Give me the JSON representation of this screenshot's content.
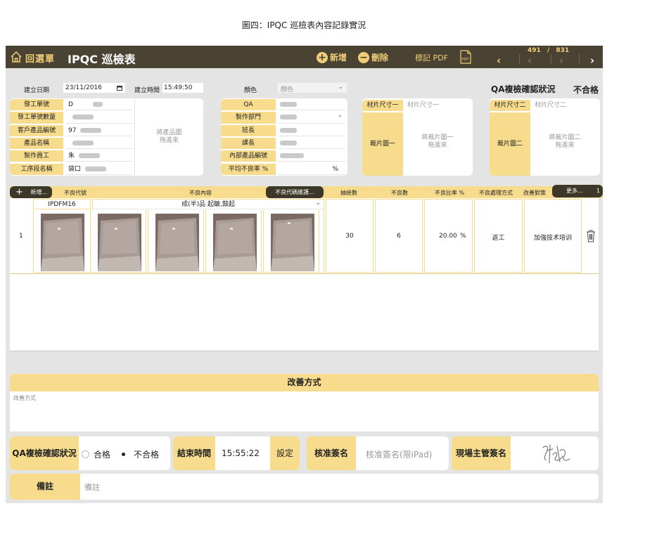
{
  "caption": "圖四：IPQC 巡檢表內容記錄實況",
  "header": {
    "back_label": "回選單",
    "title": "IPQC 巡檢表",
    "add_label": "新增",
    "delete_label": "刪除",
    "pdf_label": "標記 PDF",
    "pager_current": "491",
    "pager_sep": "/",
    "pager_total": "831"
  },
  "form": {
    "date_label": "建立日期",
    "date_value": "23/11/2016",
    "time_label": "建立時間",
    "time_value": "15:49:50",
    "color_label": "顏色",
    "color_placeholder": "顏色",
    "qa_status_title": "QA複檢確認狀況",
    "qa_status_value": "不合格",
    "left_fields": [
      {
        "label": "發工單號",
        "value": "D"
      },
      {
        "label": "發工單號數量",
        "value": ""
      },
      {
        "label": "客戶產品編號",
        "value": "97"
      },
      {
        "label": "產品名稱",
        "value": ""
      },
      {
        "label": "製作員工",
        "value": "朱"
      },
      {
        "label": "工序段名稱",
        "value": "袋口"
      }
    ],
    "product_image_hint": [
      "將產品圖",
      "拖進來"
    ],
    "mid_fields": [
      {
        "label": "QA",
        "value": ""
      },
      {
        "label": "製作部門",
        "value": ""
      },
      {
        "label": "班長",
        "value": ""
      },
      {
        "label": "課長",
        "value": ""
      },
      {
        "label": "內部產品編號",
        "value": ""
      },
      {
        "label": "平均不良率 %",
        "value": "%"
      }
    ],
    "material_size_1_label": "材片尺寸一",
    "material_size_1_placeholder": "材片尺寸一",
    "material_image_1_label": "裁片圖一",
    "material_image_1_hint": [
      "將裁片圖一",
      "拖進來"
    ],
    "material_size_2_label": "材片尺寸二",
    "material_size_2_placeholder": "材片尺寸二",
    "material_image_2_label": "裁片圖二",
    "material_image_2_hint": [
      "將裁片圖二",
      "拖進來"
    ]
  },
  "table": {
    "add_label": "新增...",
    "defect_maint_label": "不良代碼維護...",
    "more_label": "更多...",
    "more_count": "1",
    "columns": [
      "不良代號",
      "不良內容",
      "抽檢數",
      "不良數",
      "不良比率 %",
      "不良處理方式",
      "改善對策"
    ],
    "rows": [
      {
        "index": "1",
        "code": "IPDFM16",
        "content": "成(半)品 起皺,鼓起",
        "sample_count": "30",
        "defect_count": "6",
        "defect_rate": "20.00",
        "rate_unit": "%",
        "handling": "返工",
        "countermeasure": "加強技术培训"
      }
    ]
  },
  "improvement": {
    "title": "改善方式",
    "placeholder": "改善方式"
  },
  "bottom": {
    "qa_label": "QA複檢確認狀況",
    "option_pass": "合格",
    "option_fail": "不合格",
    "selected": "不合格",
    "end_time_label": "結束時間",
    "end_time_value": "15:55:22",
    "set_label": "設定",
    "approve_label": "核准簽名",
    "approve_placeholder": "核准簽名(限iPad)",
    "supervisor_label": "現場主管簽名",
    "remark_label": "備註",
    "remark_placeholder": "備註"
  },
  "colors": {
    "topbar": "#4a4232",
    "accent": "#f0cf76",
    "label_bg": "#f7dc8d",
    "app_bg": "#e4e4e4"
  }
}
